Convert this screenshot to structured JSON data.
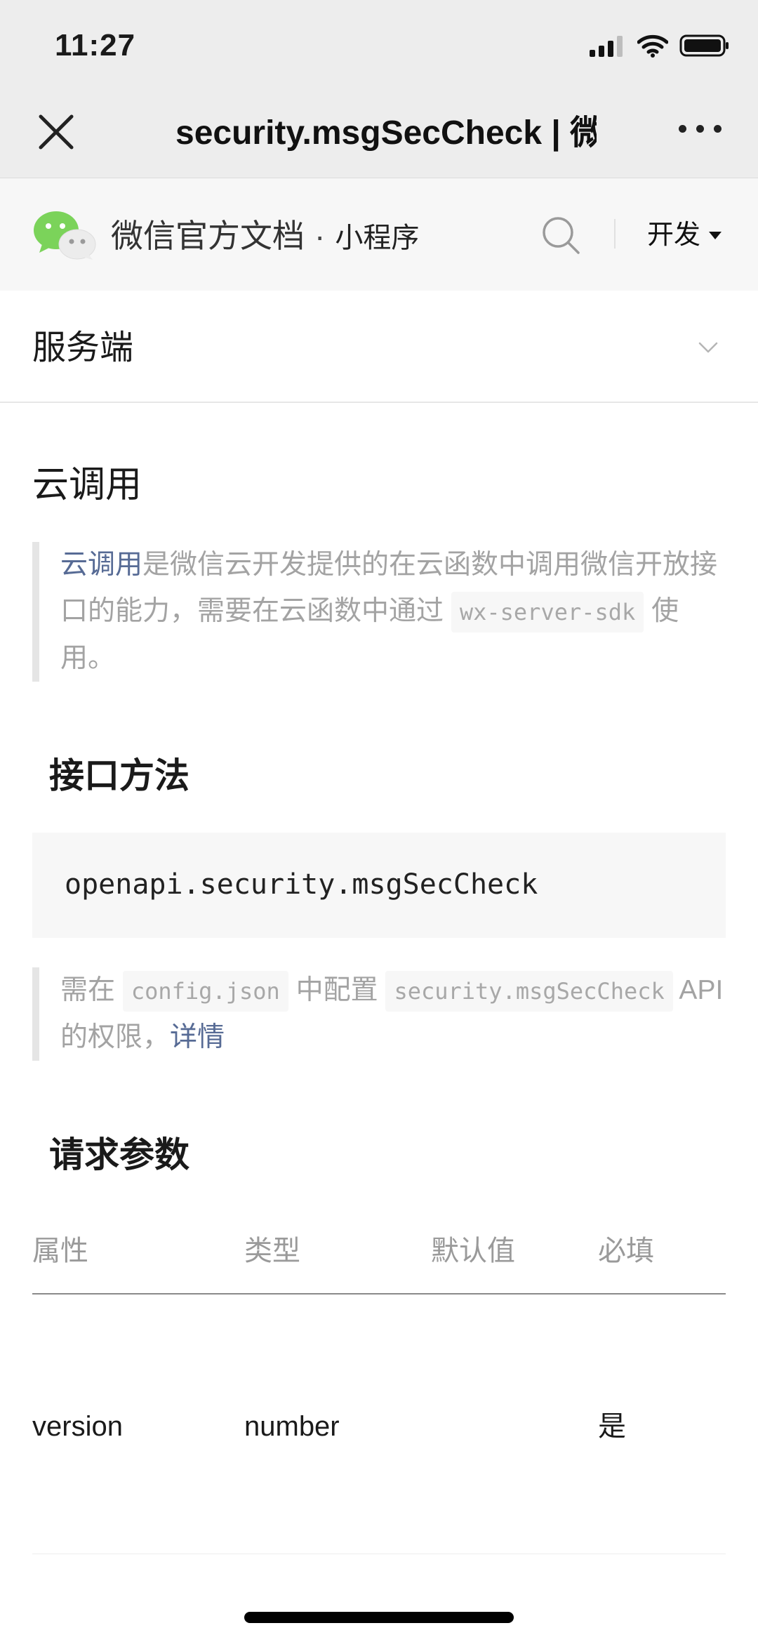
{
  "status_bar": {
    "time": "11:27"
  },
  "nav": {
    "title": "security.msgSecCheck | 微"
  },
  "doc_header": {
    "brand": "微信官方文档",
    "separator": "·",
    "section": "小程序",
    "menu_label": "开发"
  },
  "selector": {
    "label": "服务端"
  },
  "cloud": {
    "heading": "云调用",
    "link": "云调用",
    "text1": "是微信云开发提供的在云函数中调用微信开放接口的能力，需要在云函数中通过 ",
    "code": "wx-server-sdk",
    "text2": " 使用。"
  },
  "method": {
    "heading": "接口方法",
    "code": "openapi.security.msgSecCheck"
  },
  "config_note": {
    "t1": "需在 ",
    "code1": "config.json",
    "t2": " 中配置 ",
    "code2": "security.msgSecCheck",
    "t3": " API 的权限，",
    "link": "详情"
  },
  "params": {
    "heading": "请求参数",
    "columns": [
      "属性",
      "类型",
      "默认值",
      "必填"
    ],
    "rows": [
      [
        "version",
        "number",
        "",
        "是"
      ]
    ]
  }
}
